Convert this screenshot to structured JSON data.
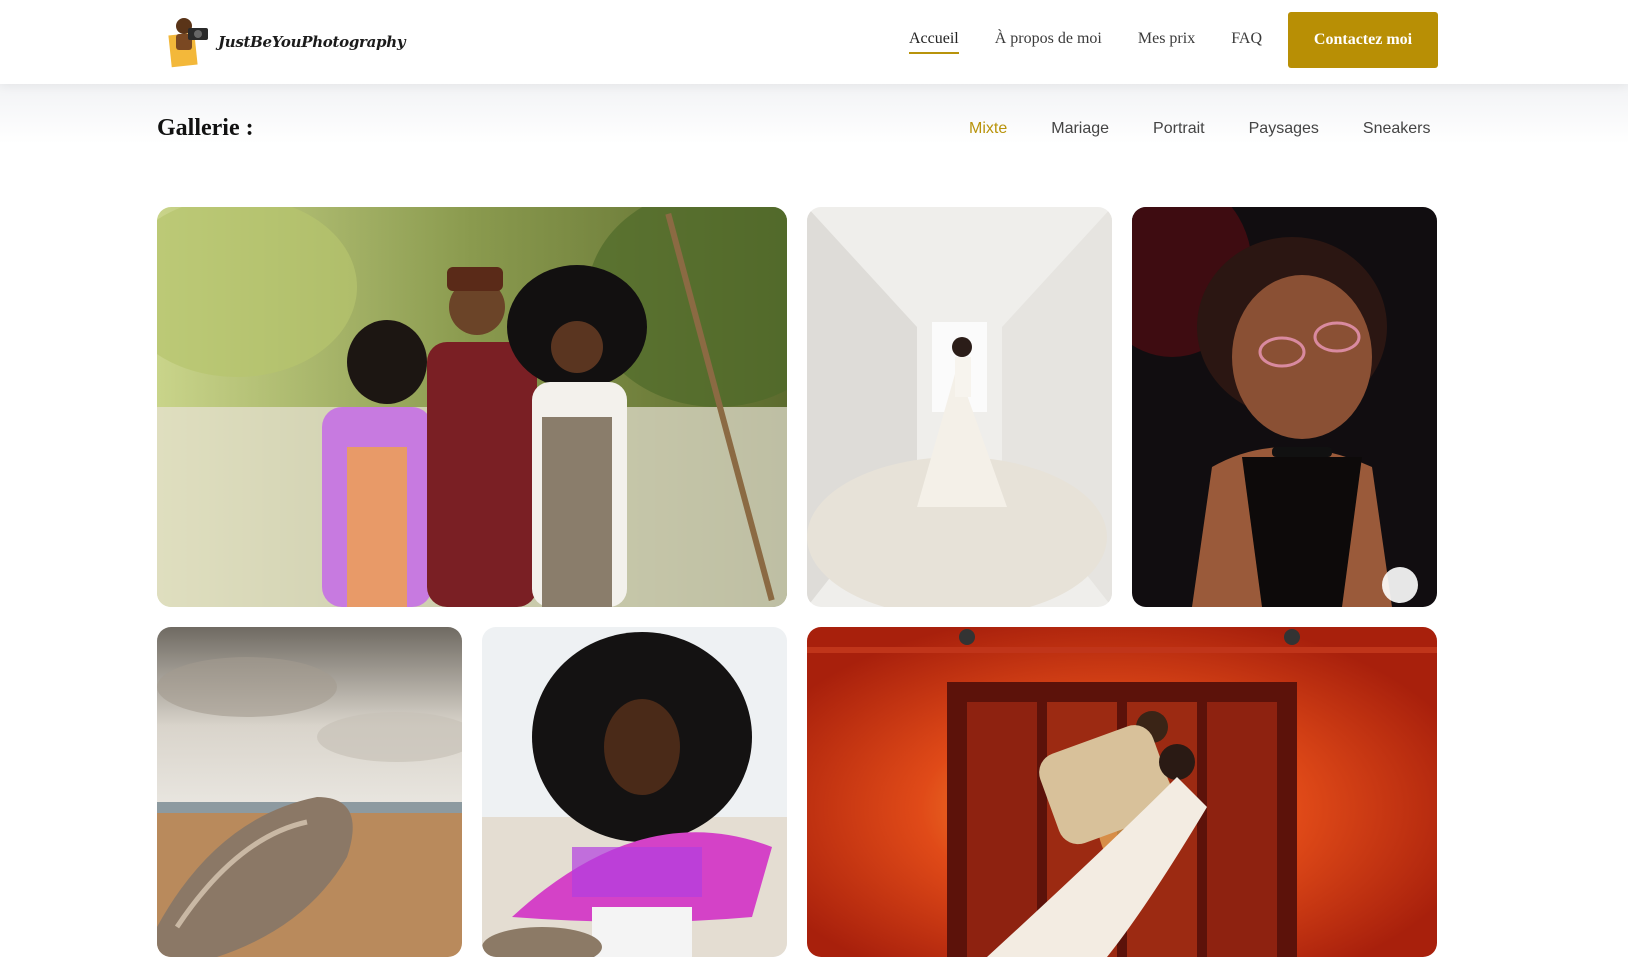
{
  "brand": {
    "name": "JustBeYouPhotography"
  },
  "nav": {
    "items": [
      {
        "label": "Accueil",
        "active": true
      },
      {
        "label": "À propos de moi",
        "active": false
      },
      {
        "label": "Mes prix",
        "active": false
      },
      {
        "label": "FAQ",
        "active": false
      }
    ],
    "cta_label": "Contactez moi"
  },
  "gallery": {
    "title": "Gallerie :",
    "filters": [
      {
        "label": "Mixte",
        "active": true
      },
      {
        "label": "Mariage",
        "active": false
      },
      {
        "label": "Portrait",
        "active": false
      },
      {
        "label": "Paysages",
        "active": false
      },
      {
        "label": "Sneakers",
        "active": false
      }
    ]
  },
  "colors": {
    "accent": "#b8930b",
    "button": "#b88f05"
  }
}
